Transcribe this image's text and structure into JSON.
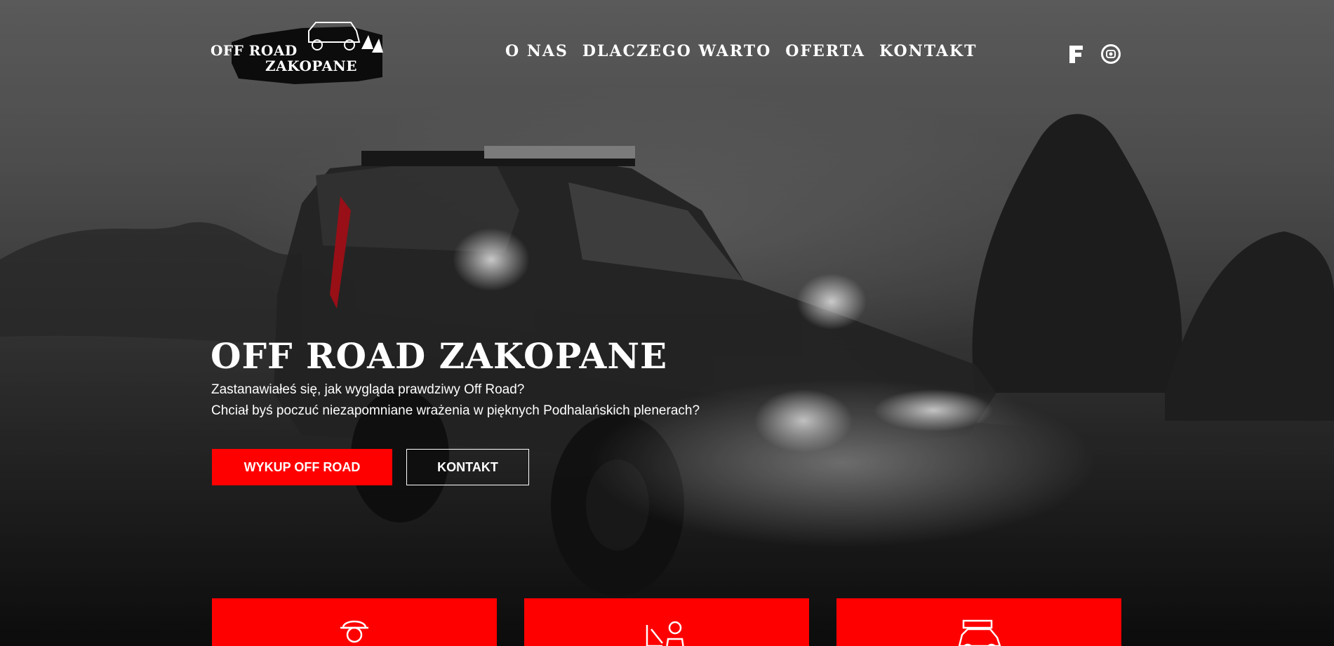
{
  "header": {
    "logo": {
      "line1": "OFF ROAD",
      "line2": "ZAKOPANE",
      "icon": "jeep-logo-icon"
    },
    "nav": [
      {
        "label": "O NAS"
      },
      {
        "label": "DLACZEGO WARTO"
      },
      {
        "label": "OFERTA"
      },
      {
        "label": "KONTAKT"
      }
    ],
    "social": [
      {
        "icon": "facebook-icon"
      },
      {
        "icon": "instagram-icon"
      }
    ]
  },
  "hero": {
    "title": "OFF ROAD ZAKOPANE",
    "lines": [
      "Zastanawiałeś się, jak wygląda prawdziwy Off Road?",
      "Chciał byś poczuć niezapomniane wrażenia w pięknych Podhalańskich plenerach?"
    ],
    "buttons": {
      "primary": "WYKUP OFF ROAD",
      "secondary": "KONTAKT"
    },
    "background": "foggy-offroad-suv-photo"
  },
  "cards": [
    {
      "icon": "driver-icon"
    },
    {
      "icon": "mechanic-icon"
    },
    {
      "icon": "offroad-car-icon"
    }
  ],
  "colors": {
    "accent": "#ff0000",
    "text": "#ffffff"
  }
}
